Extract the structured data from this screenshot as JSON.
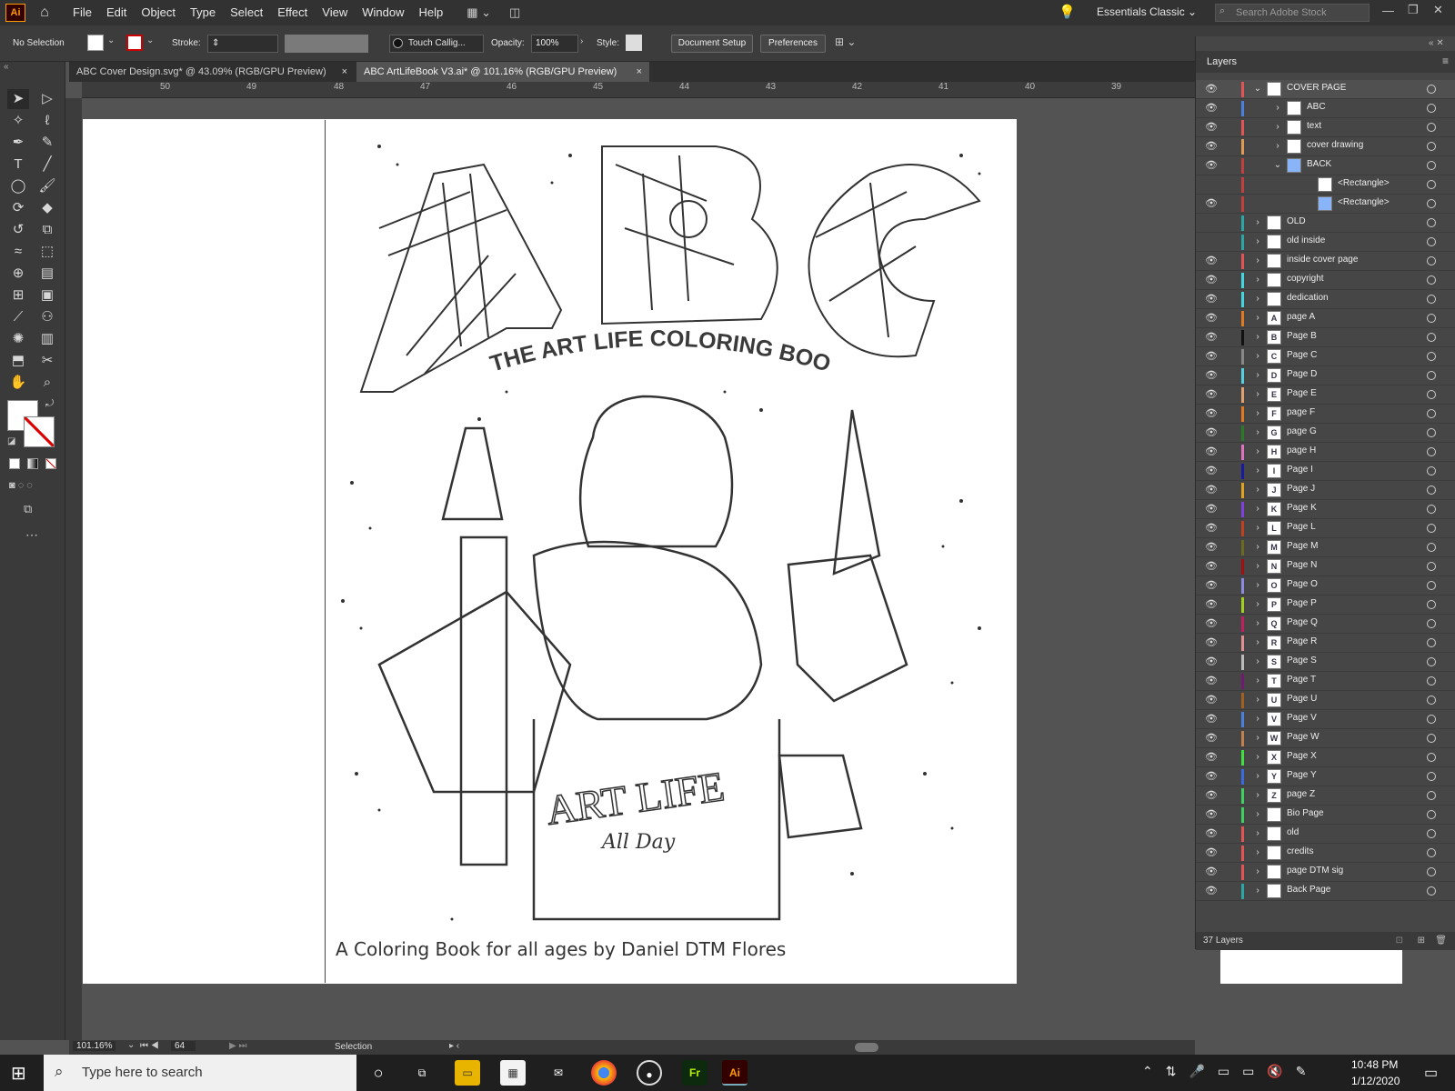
{
  "app": {
    "logo": "Ai",
    "menu": [
      "File",
      "Edit",
      "Object",
      "Type",
      "Select",
      "Effect",
      "View",
      "Window",
      "Help"
    ],
    "workspace": "Essentials Classic",
    "stock_search_placeholder": "Search Adobe Stock"
  },
  "control_bar": {
    "selection_status": "No Selection",
    "stroke_label": "Stroke:",
    "brush_name": "Touch Callig...",
    "opacity_label": "Opacity:",
    "opacity_value": "100%",
    "style_label": "Style:",
    "document_setup": "Document Setup",
    "preferences": "Preferences"
  },
  "tabs": [
    {
      "label": "ABC Cover Design.svg* @ 43.09% (RGB/GPU Preview)",
      "close": "×"
    },
    {
      "label": "ABC ArtLifeBook V3.ai* @ 101.16% (RGB/GPU Preview)",
      "close": "×"
    }
  ],
  "ruler": {
    "h_labels": [
      "50",
      "49",
      "48",
      "47",
      "46",
      "45",
      "44",
      "43",
      "42",
      "41",
      "40",
      "39"
    ]
  },
  "artboard": {
    "title": "THE ART LIFE COLORING BOOK",
    "letters": [
      "A",
      "B",
      "C"
    ],
    "shirt_text": "ART LIFE",
    "shirt_script": "All Day",
    "caption": "A Coloring Book for all ages by Daniel DTM Flores"
  },
  "layers_panel": {
    "title": "Layers",
    "count_label": "37 Layers",
    "layers": [
      {
        "name": "COVER PAGE",
        "color": "#e25555",
        "thumb": "",
        "expanded": true,
        "indent": 0
      },
      {
        "name": "ABC",
        "color": "#4a7fe0",
        "thumb": "",
        "indent": 1
      },
      {
        "name": "text",
        "color": "#e25555",
        "thumb": "",
        "indent": 1
      },
      {
        "name": "cover drawing",
        "color": "#e09a55",
        "thumb": "",
        "indent": 1
      },
      {
        "name": "BACK",
        "color": "#c04040",
        "thumb": "",
        "expanded": true,
        "indent": 1
      },
      {
        "name": "<Rectangle>",
        "color": "#c04040",
        "thumb": "",
        "indent": 2
      },
      {
        "name": "<Rectangle>",
        "color": "#c04040",
        "thumb": "",
        "indent": 2
      },
      {
        "name": "OLD",
        "color": "#2aa6a6",
        "thumb": "",
        "indent": 0
      },
      {
        "name": "old inside",
        "color": "#2aa6a6",
        "thumb": "",
        "indent": 0
      },
      {
        "name": "inside cover page",
        "color": "#e25555",
        "thumb": "",
        "indent": 0
      },
      {
        "name": "copyright",
        "color": "#44d6e0",
        "thumb": "",
        "indent": 0
      },
      {
        "name": "dedication",
        "color": "#44d6e0",
        "thumb": "",
        "indent": 0
      },
      {
        "name": "page A",
        "color": "#e07a20",
        "thumb": "A",
        "indent": 0
      },
      {
        "name": "Page B",
        "color": "#111111",
        "thumb": "B",
        "indent": 0
      },
      {
        "name": "Page C",
        "color": "#888888",
        "thumb": "C",
        "indent": 0
      },
      {
        "name": "Page D",
        "color": "#55d0e0",
        "thumb": "D",
        "indent": 0
      },
      {
        "name": "Page E",
        "color": "#e0a070",
        "thumb": "E",
        "indent": 0
      },
      {
        "name": "page F",
        "color": "#e07a20",
        "thumb": "F",
        "indent": 0
      },
      {
        "name": "page G",
        "color": "#2a7a2a",
        "thumb": "G",
        "indent": 0
      },
      {
        "name": "page H",
        "color": "#e070c0",
        "thumb": "H",
        "indent": 0
      },
      {
        "name": "Page I",
        "color": "#1a1aa0",
        "thumb": "I",
        "indent": 0
      },
      {
        "name": "Page J",
        "color": "#e0a020",
        "thumb": "J",
        "indent": 0
      },
      {
        "name": "Page K",
        "color": "#8040e0",
        "thumb": "K",
        "indent": 0
      },
      {
        "name": "Page L",
        "color": "#c04020",
        "thumb": "L",
        "indent": 0
      },
      {
        "name": "Page M",
        "color": "#6a6a20",
        "thumb": "M",
        "indent": 0
      },
      {
        "name": "Page N",
        "color": "#a01010",
        "thumb": "N",
        "indent": 0
      },
      {
        "name": "Page O",
        "color": "#8a8ae0",
        "thumb": "O",
        "indent": 0
      },
      {
        "name": "Page P",
        "color": "#a0d020",
        "thumb": "P",
        "indent": 0
      },
      {
        "name": "Page Q",
        "color": "#c02060",
        "thumb": "Q",
        "indent": 0
      },
      {
        "name": "Page R",
        "color": "#e09090",
        "thumb": "R",
        "indent": 0
      },
      {
        "name": "Page S",
        "color": "#bbbbbb",
        "thumb": "S",
        "indent": 0
      },
      {
        "name": "Page T",
        "color": "#701a70",
        "thumb": "T",
        "indent": 0
      },
      {
        "name": "Page U",
        "color": "#a06020",
        "thumb": "U",
        "indent": 0
      },
      {
        "name": "Page V",
        "color": "#4a7fe0",
        "thumb": "V",
        "indent": 0
      },
      {
        "name": "Page W",
        "color": "#c08050",
        "thumb": "W",
        "indent": 0
      },
      {
        "name": "Page X",
        "color": "#40e040",
        "thumb": "X",
        "indent": 0
      },
      {
        "name": "Page Y",
        "color": "#3a6ae0",
        "thumb": "Y",
        "indent": 0
      },
      {
        "name": "page Z",
        "color": "#40d060",
        "thumb": "Z",
        "indent": 0
      },
      {
        "name": "Bio Page",
        "color": "#40d060",
        "thumb": "",
        "indent": 0
      },
      {
        "name": "old",
        "color": "#e25555",
        "thumb": "",
        "indent": 0
      },
      {
        "name": "credits",
        "color": "#e25555",
        "thumb": "",
        "indent": 0
      },
      {
        "name": "page DTM sig",
        "color": "#e25555",
        "thumb": "",
        "indent": 0
      },
      {
        "name": "Back Page",
        "color": "#2aa6a6",
        "thumb": "",
        "indent": 0
      }
    ]
  },
  "status": {
    "zoom": "101.16%",
    "artboard_num": "64",
    "tool": "Selection"
  },
  "taskbar": {
    "search_placeholder": "Type here to search",
    "time": "10:48 PM",
    "date": "1/12/2020"
  }
}
